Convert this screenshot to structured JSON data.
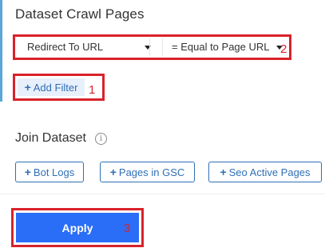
{
  "section": {
    "title": "Dataset Crawl Pages"
  },
  "filter": {
    "field_value": "Redirect To URL",
    "operator_value": "= Equal to Page URL",
    "add_label": "Add Filter"
  },
  "join": {
    "title": "Join Dataset",
    "info_glyph": "i",
    "datasets": [
      {
        "label": "Bot Logs"
      },
      {
        "label": "Pages in GSC"
      },
      {
        "label": "Seo Active Pages"
      }
    ]
  },
  "apply": {
    "label": "Apply"
  },
  "annotations": {
    "one": "1",
    "two": "2",
    "three": "3"
  },
  "icons": {
    "plus": "+",
    "caret": "chevron-down-icon",
    "info": "info-icon"
  },
  "colors": {
    "accent_blue": "#2f6fb5",
    "apply_bg": "#2a6ef7",
    "annotation_red": "#d9222a",
    "left_bar": "#5aa6d6"
  }
}
